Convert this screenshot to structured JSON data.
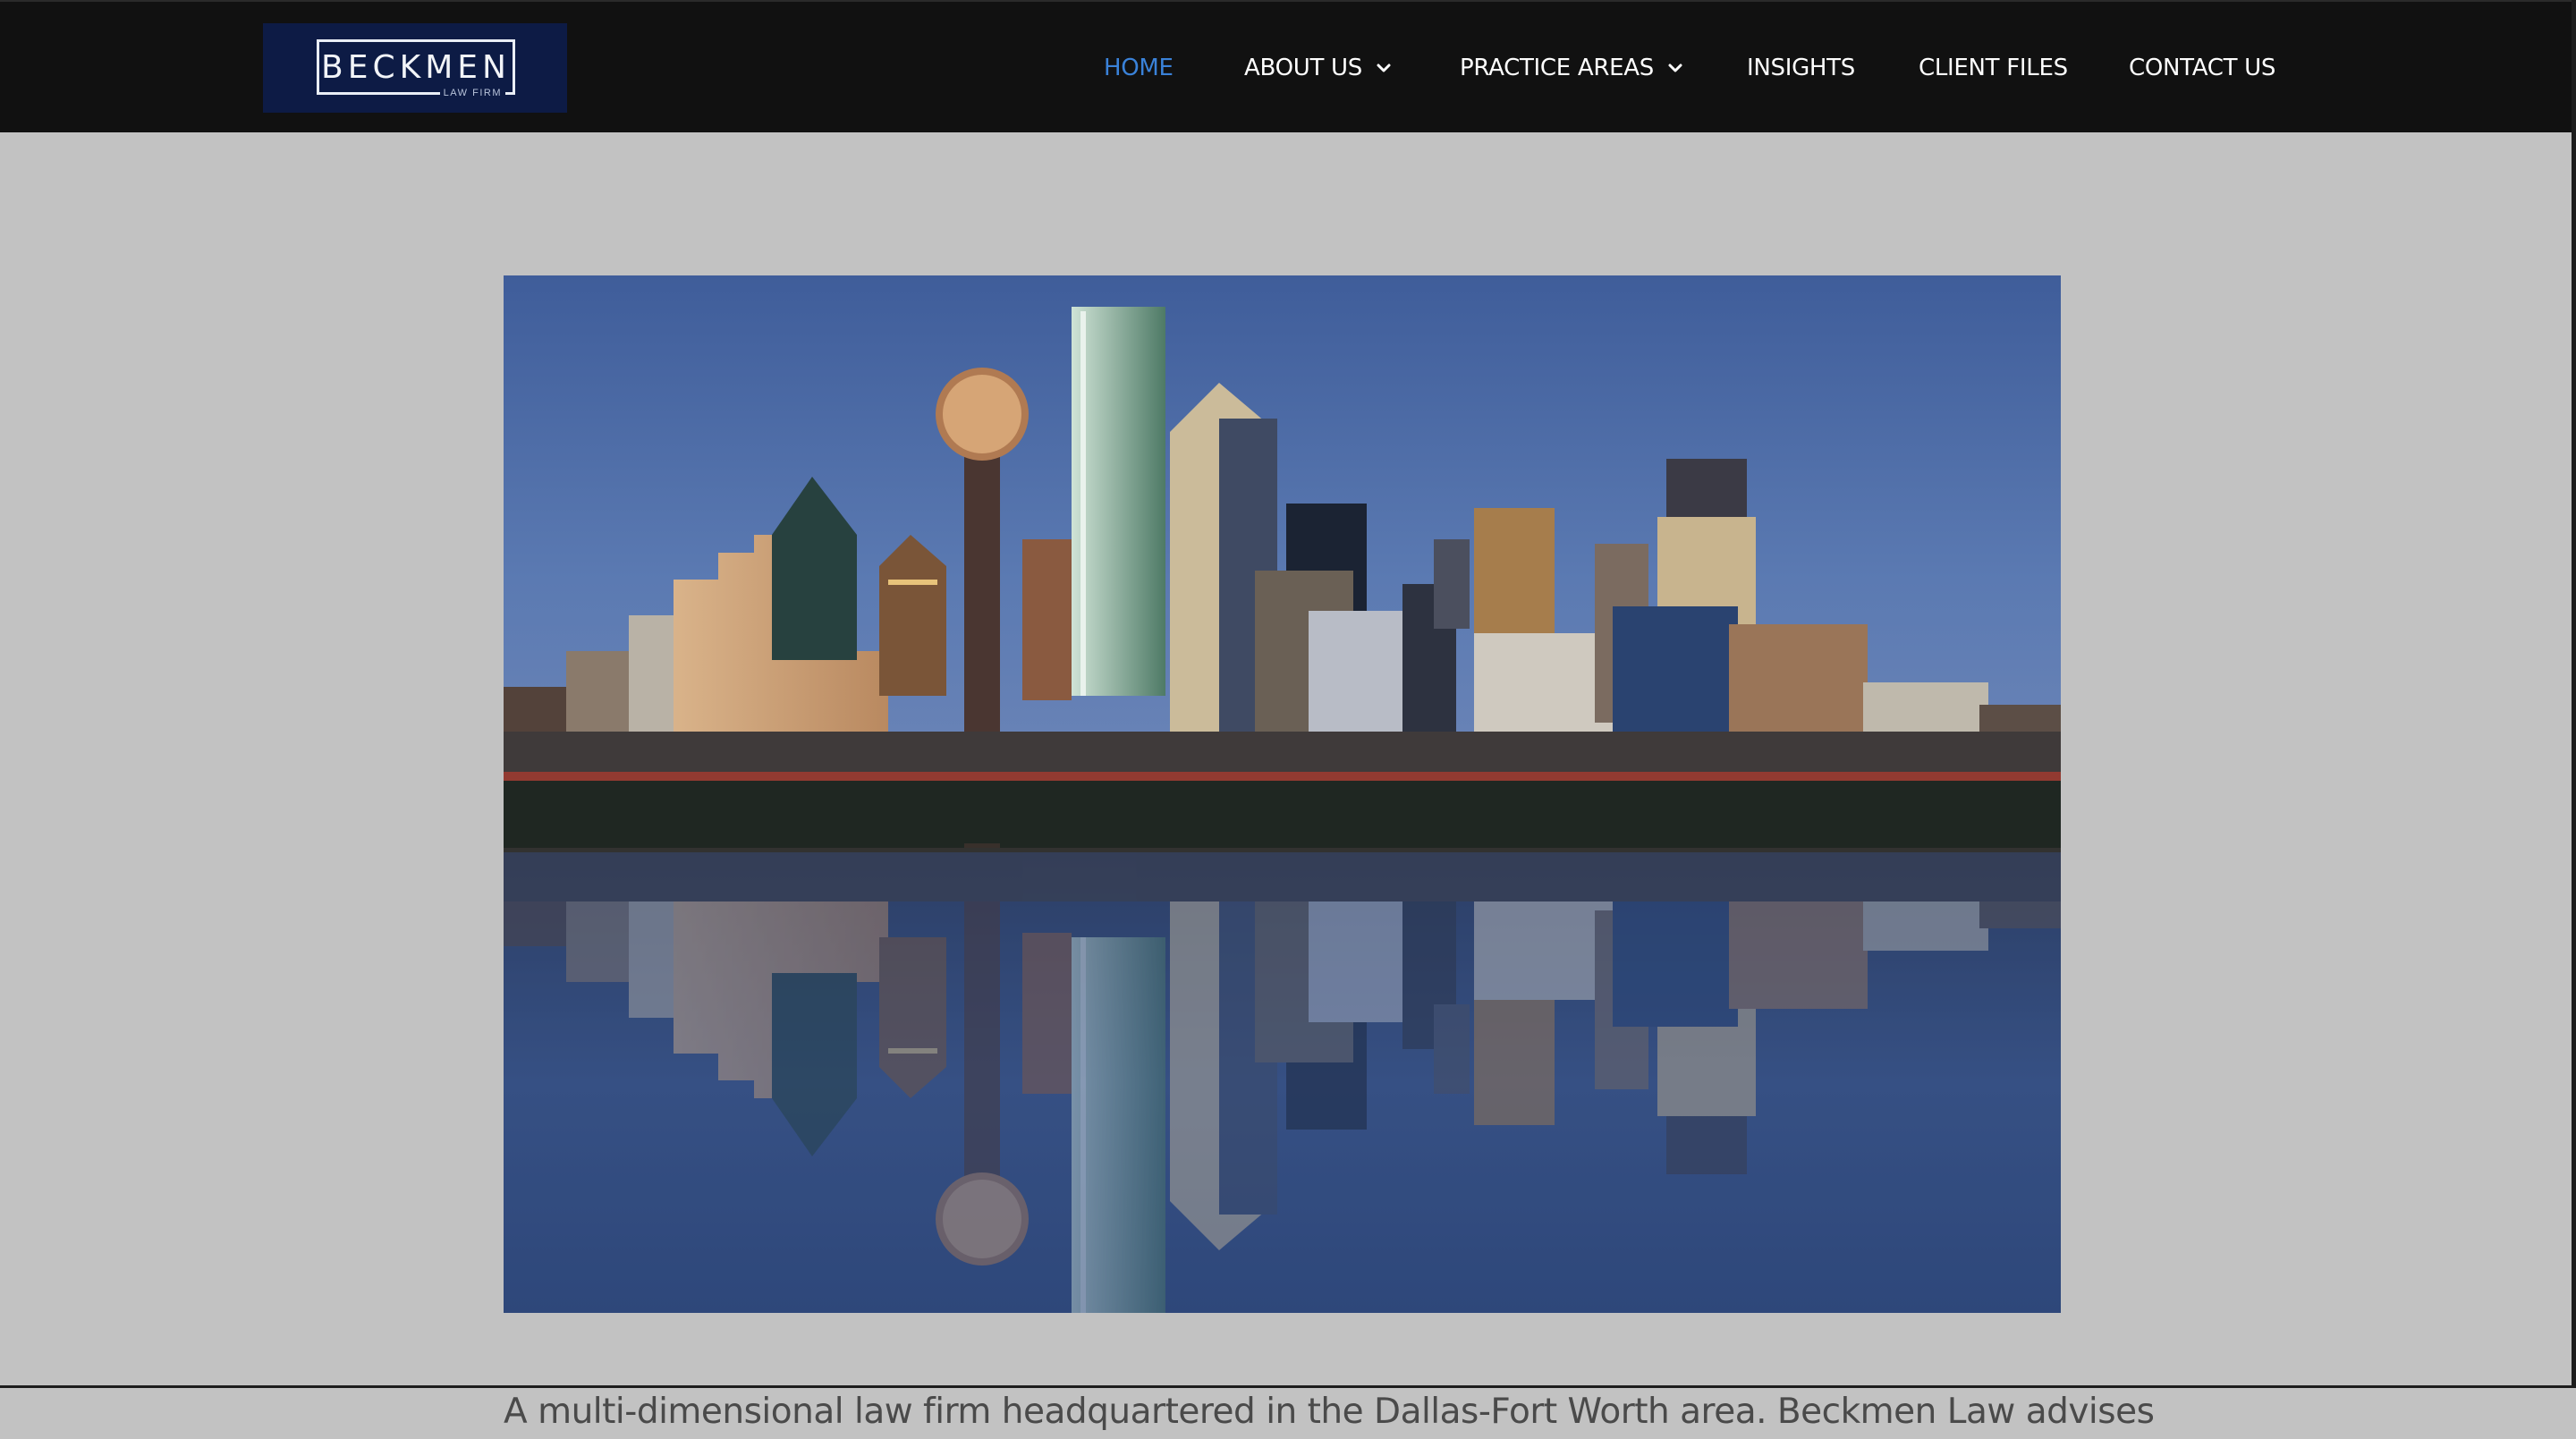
{
  "brand": {
    "name": "BECKMEN",
    "tagline": "LAW FIRM",
    "logo_bg": "#0d1b45"
  },
  "nav": {
    "items": [
      {
        "label": "HOME",
        "active": true,
        "dropdown": false
      },
      {
        "label": "ABOUT US",
        "active": false,
        "dropdown": true
      },
      {
        "label": "PRACTICE AREAS",
        "active": false,
        "dropdown": true
      },
      {
        "label": "INSIGHTS",
        "active": false,
        "dropdown": false
      },
      {
        "label": "CLIENT FILES",
        "active": false,
        "dropdown": false
      },
      {
        "label": "CONTACT US",
        "active": false,
        "dropdown": false
      }
    ],
    "active_color": "#3a82d9",
    "icons": [
      "chevron-down-icon"
    ]
  },
  "hero": {
    "image_subject": "city-skyline-reflection"
  },
  "intro": {
    "text": "A multi-dimensional law firm headquartered in the Dallas-Fort Worth area. Beckmen Law advises"
  },
  "colors": {
    "page_bg": "#c2c2c2",
    "header_bg": "#111111",
    "body_text": "#4a4a4a"
  }
}
